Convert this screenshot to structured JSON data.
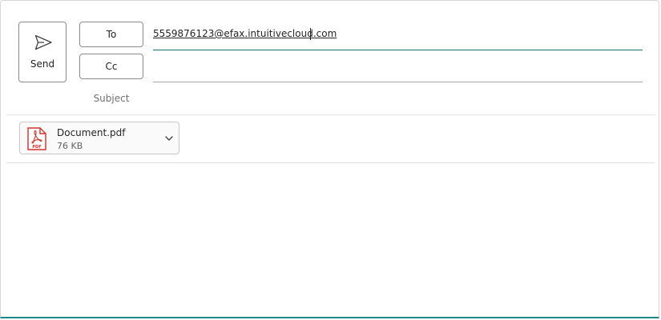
{
  "compose": {
    "send_label": "Send",
    "to_label": "To",
    "cc_label": "Cc",
    "subject_label": "Subject",
    "to_value": "5559876123@efax.intuitivecloud.com",
    "cc_value": ""
  },
  "attachment": {
    "icon": "pdf-file-icon",
    "icon_text": "PDF",
    "name": "Document.pdf",
    "size": "76 KB"
  },
  "colors": {
    "accent": "#1b6f6d",
    "pdf_red": "#d1312a"
  }
}
